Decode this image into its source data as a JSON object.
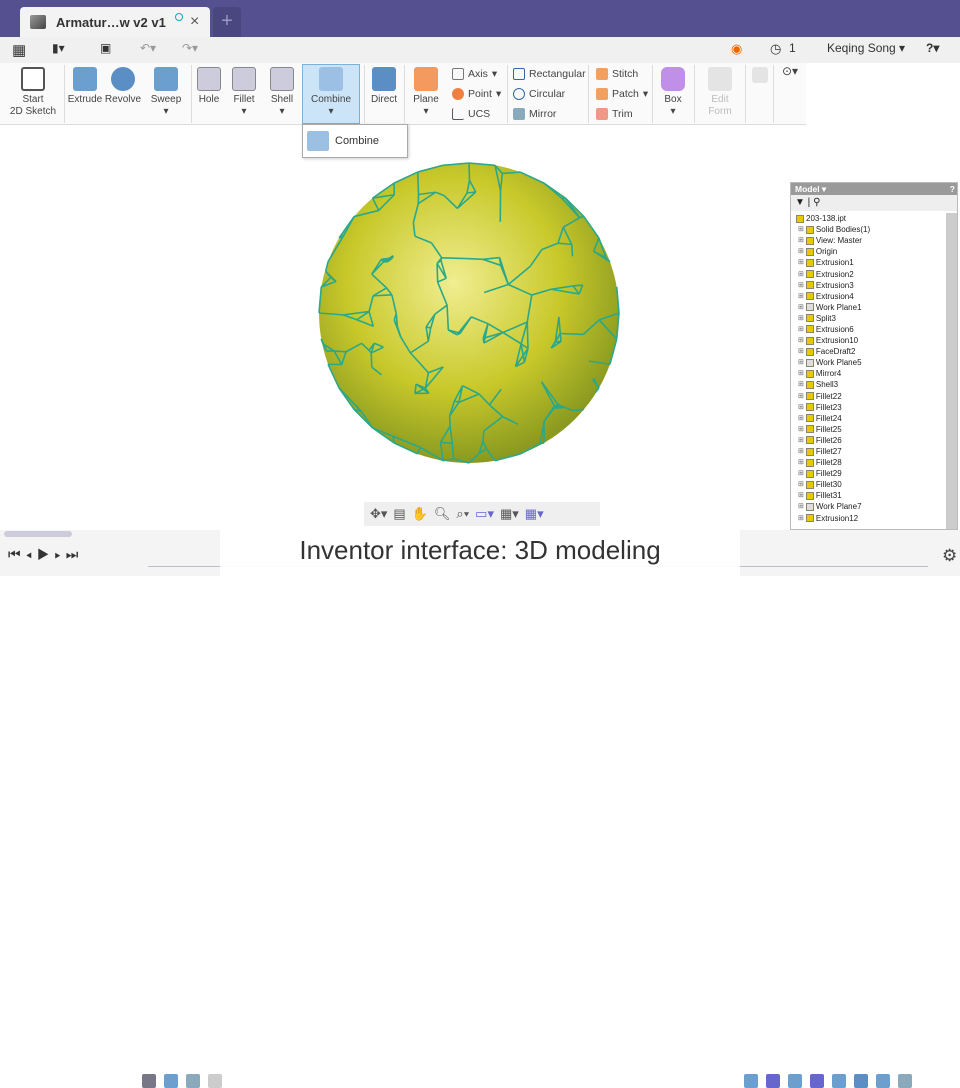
{
  "window": {
    "tab_title": "Armatur…w v2 v1",
    "close": "×",
    "new_tab": "+"
  },
  "toolbar": {
    "record_icon": "record-icon",
    "jobs_count": "1",
    "user": "Keqing Song ▾",
    "help": "?▾"
  },
  "ribbon": {
    "start_sketch": [
      "Start",
      "2D Sketch"
    ],
    "extrude": "Extrude",
    "revolve": "Revolve",
    "sweep": "Sweep",
    "hole": "Hole",
    "fillet": "Fillet",
    "shell": "Shell",
    "combine": "Combine",
    "direct": "Direct",
    "plane": "Plane",
    "axis": "Axis",
    "point": "Point",
    "ucs": "UCS",
    "rectangular": "Rectangular",
    "circular": "Circular",
    "mirror": "Mirror",
    "stitch": "Stitch",
    "patch": "Patch",
    "trim": "Trim",
    "box": "Box",
    "edit_form": [
      "Edit",
      "Form"
    ]
  },
  "dropdown": {
    "combine_item": "Combine"
  },
  "browser": {
    "title": "Model ▾",
    "help": "?",
    "items": [
      "203-138.ipt",
      "Solid Bodies(1)",
      "View: Master",
      "Origin",
      "Extrusion1",
      "Extrusion2",
      "Extrusion3",
      "Extrusion4",
      "Work Plane1",
      "Split3",
      "Extrusion6",
      "Extrusion10",
      "FaceDraft2",
      "Work Plane5",
      "Mirror4",
      "Shell3",
      "Fillet22",
      "Fillet23",
      "Fillet24",
      "Fillet25",
      "Fillet26",
      "Fillet27",
      "Fillet28",
      "Fillet29",
      "Fillet30",
      "Fillet31",
      "Work Plane7",
      "Extrusion12"
    ]
  },
  "caption": "Inventor interface: 3D modeling",
  "colors": {
    "titlebar": "#55508f",
    "mesh": "#2aa889",
    "sphere": "#d6d43a"
  }
}
